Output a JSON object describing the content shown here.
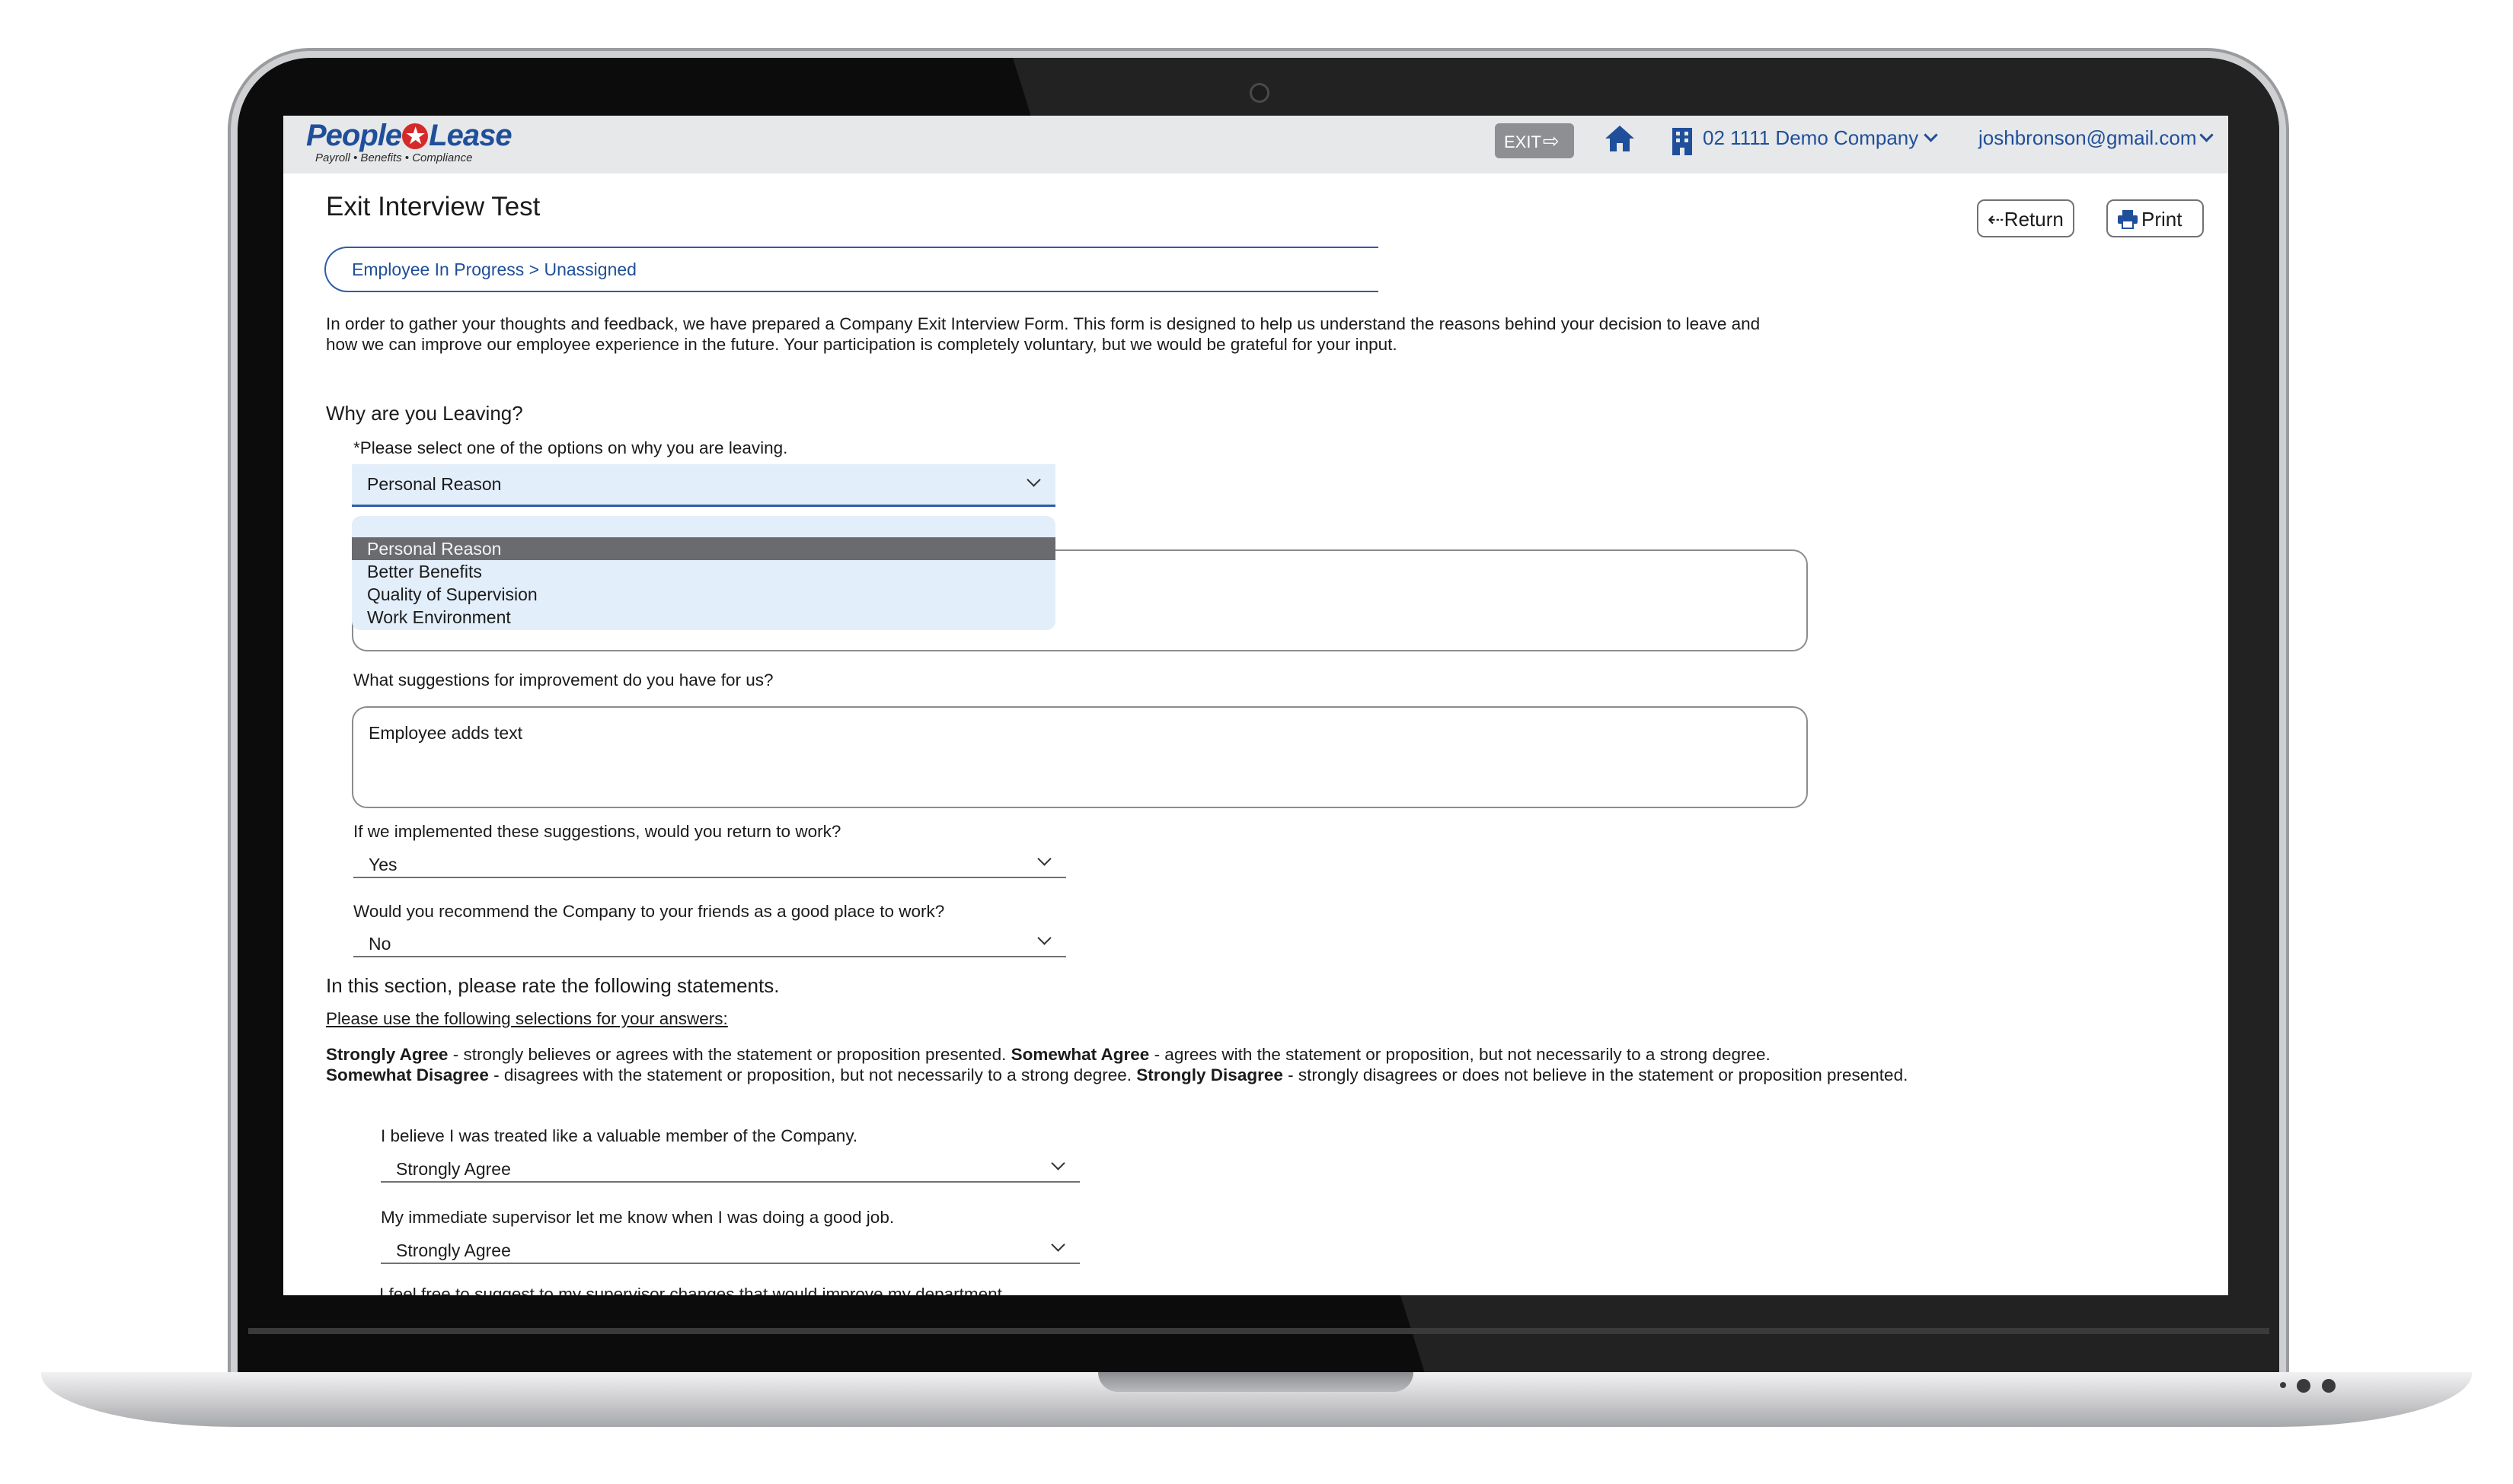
{
  "header": {
    "logo_text_1": "People",
    "logo_text_2": "Lease",
    "logo_tagline": "Payroll • Benefits • Compliance",
    "exit_label": "EXIT",
    "company": "02 1111 Demo Company",
    "user_email": "joshbronson@gmail.com"
  },
  "page": {
    "title": "Exit Interview Test",
    "return_label": "Return",
    "print_label": "Print",
    "status": "Employee In Progress > Unassigned",
    "intro": "In order to gather your thoughts and feedback, we have prepared a Company Exit Interview Form. This form is designed to help us understand the reasons behind your decision to leave and how we can improve our employee experience in the future. Your participation is completely voluntary, but we would be grateful for your input."
  },
  "form": {
    "why_heading": "Why are you Leaving?",
    "reason_prompt": "*Please select one of the options on why you are leaving.",
    "reason_selected": "Personal Reason",
    "reason_options": [
      "Personal Reason",
      "Better Benefits",
      "Quality of Supervision",
      "Work Environment"
    ],
    "suggestions_prompt": "What suggestions for improvement do you have for us?",
    "suggestions_value": "Employee adds text",
    "return_prompt": "If we implemented these suggestions, would you return to work?",
    "return_value": "Yes",
    "recommend_prompt": "Would you recommend the Company to your friends as a good place to work?",
    "recommend_value": "No"
  },
  "rating": {
    "heading": "In this section, please rate the following statements.",
    "instructions": "Please use the following selections for your answers:",
    "sa_term": "Strongly Agree",
    "sa_desc": " - strongly believes or agrees with the statement or proposition presented. ",
    "wa_term": "Somewhat Agree",
    "wa_desc": " - agrees with the statement or proposition, but not necessarily to a strong degree.",
    "wd_term": "Somewhat Disagree",
    "wd_desc": " - disagrees with the statement or proposition, but not necessarily to a strong degree. ",
    "sd_term": "Strongly Disagree",
    "sd_desc": " - strongly disagrees or does not believe in the statement or proposition presented.",
    "statements": [
      {
        "text": "I believe I was treated like a valuable member of the Company.",
        "value": "Strongly Agree"
      },
      {
        "text": "My immediate supervisor let me know when I was doing a good job.",
        "value": "Strongly Agree"
      },
      {
        "text": "I feel free to suggest to my supervisor changes that would improve my department."
      }
    ]
  }
}
